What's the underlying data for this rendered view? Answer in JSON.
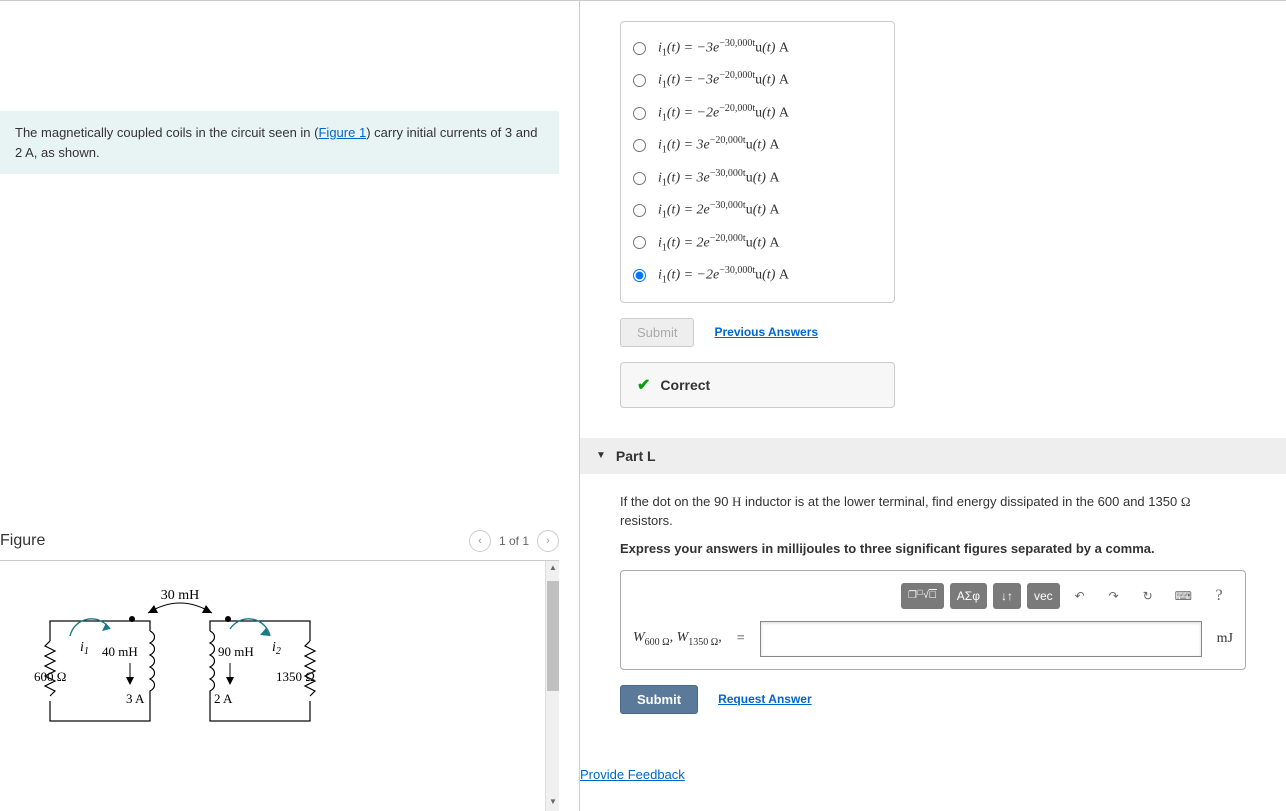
{
  "problem": {
    "text_before": "The magnetically coupled coils in the circuit seen in (",
    "figure_link": "Figure 1",
    "text_after": ") carry initial currents of 3 and 2 A, as shown."
  },
  "figure": {
    "title": "Figure",
    "page_indicator": "1 of 1",
    "labels": {
      "mutual": "30 mH",
      "L1": "40 mH",
      "L2": "90 mH",
      "i1": "i₁",
      "i2": "i₂",
      "R1": "600 Ω",
      "R2": "1350 Ω",
      "I1": "3 A",
      "I2": "2 A"
    }
  },
  "choices": [
    {
      "coef": "−3",
      "exp": "−30,000",
      "selected": false
    },
    {
      "coef": "−3",
      "exp": "−20,000",
      "selected": false
    },
    {
      "coef": "−2",
      "exp": "−20,000",
      "selected": false
    },
    {
      "coef": "3",
      "exp": "−20,000",
      "selected": false
    },
    {
      "coef": "3",
      "exp": "−30,000",
      "selected": false
    },
    {
      "coef": "2",
      "exp": "−30,000",
      "selected": false
    },
    {
      "coef": "2",
      "exp": "−20,000",
      "selected": false
    },
    {
      "coef": "−2",
      "exp": "−30,000",
      "selected": true
    }
  ],
  "buttons": {
    "submit_disabled": "Submit",
    "previous_answers": "Previous Answers",
    "submit_active": "Submit",
    "request_answer": "Request Answer"
  },
  "feedback": {
    "text": "Correct"
  },
  "partL": {
    "title": "Part L",
    "question_prefix": "If the dot on the 90 ",
    "question_H": "H",
    "question_mid": " inductor is at the lower terminal, find energy dissipated in the 600 and 1350 ",
    "question_ohm": "Ω",
    "question_suffix": " resistors.",
    "instruction": "Express your answers in millijoules to three significant figures separated by a comma.",
    "answer_label_W1": "W",
    "answer_label_sub1": "600 Ω",
    "answer_label_W2": "W",
    "answer_label_sub2": "1350 Ω",
    "equals": "=",
    "unit": "mJ"
  },
  "toolbar": {
    "templates": "❐√☐",
    "greek": "ΑΣφ",
    "updown": "↓↑",
    "vec": "vec",
    "undo": "↶",
    "redo": "↷",
    "reset": "↻",
    "keyboard": "⌨",
    "help": "?"
  },
  "feedback_link": "Provide Feedback"
}
